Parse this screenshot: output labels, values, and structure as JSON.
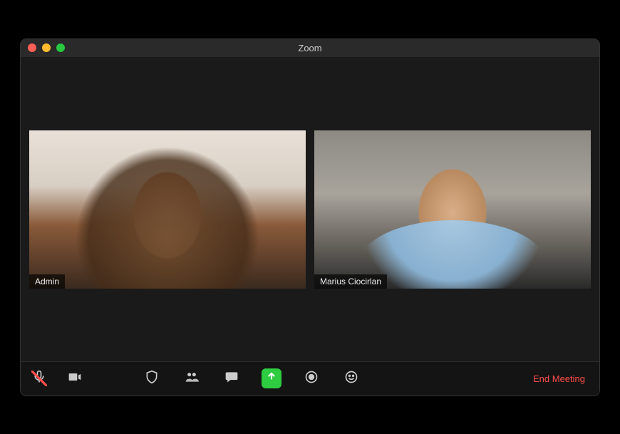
{
  "window": {
    "title": "Zoom"
  },
  "participants": [
    {
      "name": "Admin",
      "speaking": true
    },
    {
      "name": "Marius Ciocirlan",
      "speaking": false
    }
  ],
  "toolbar": {
    "mute": "Mute",
    "video": "Stop Video",
    "security": "Security",
    "participants": "Participants",
    "chat": "Chat",
    "share": "Share Screen",
    "record": "Record",
    "reactions": "Reactions",
    "end": "End Meeting"
  },
  "colors": {
    "speaking_border": "#b6e61e",
    "share_green": "#2ecc40",
    "end_red": "#ff4d4d"
  }
}
